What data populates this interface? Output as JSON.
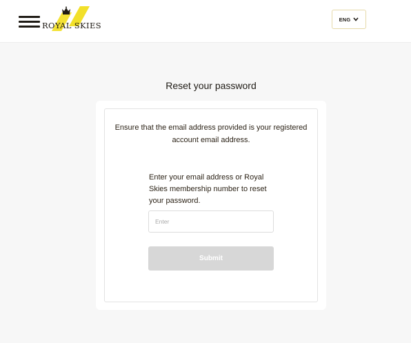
{
  "header": {
    "logo_text": "ROYAL SKIES",
    "language": {
      "selected": "ENG"
    }
  },
  "main": {
    "title": "Reset your password",
    "notice": "Ensure that the email address provided is your registered account email address.",
    "instruction": "Enter your email address or Royal Skies membership number to reset your password.",
    "input": {
      "value": "",
      "placeholder": "Enter"
    },
    "submit_label": "Submit"
  },
  "colors": {
    "brand_yellow": "#f2e02a",
    "text_dark": "#1e1a14",
    "button_disabled": "#d7d7d7"
  },
  "icons": {
    "menu": "hamburger-icon",
    "logo_mark": "crown-icon",
    "dropdown": "chevron-down-icon"
  }
}
